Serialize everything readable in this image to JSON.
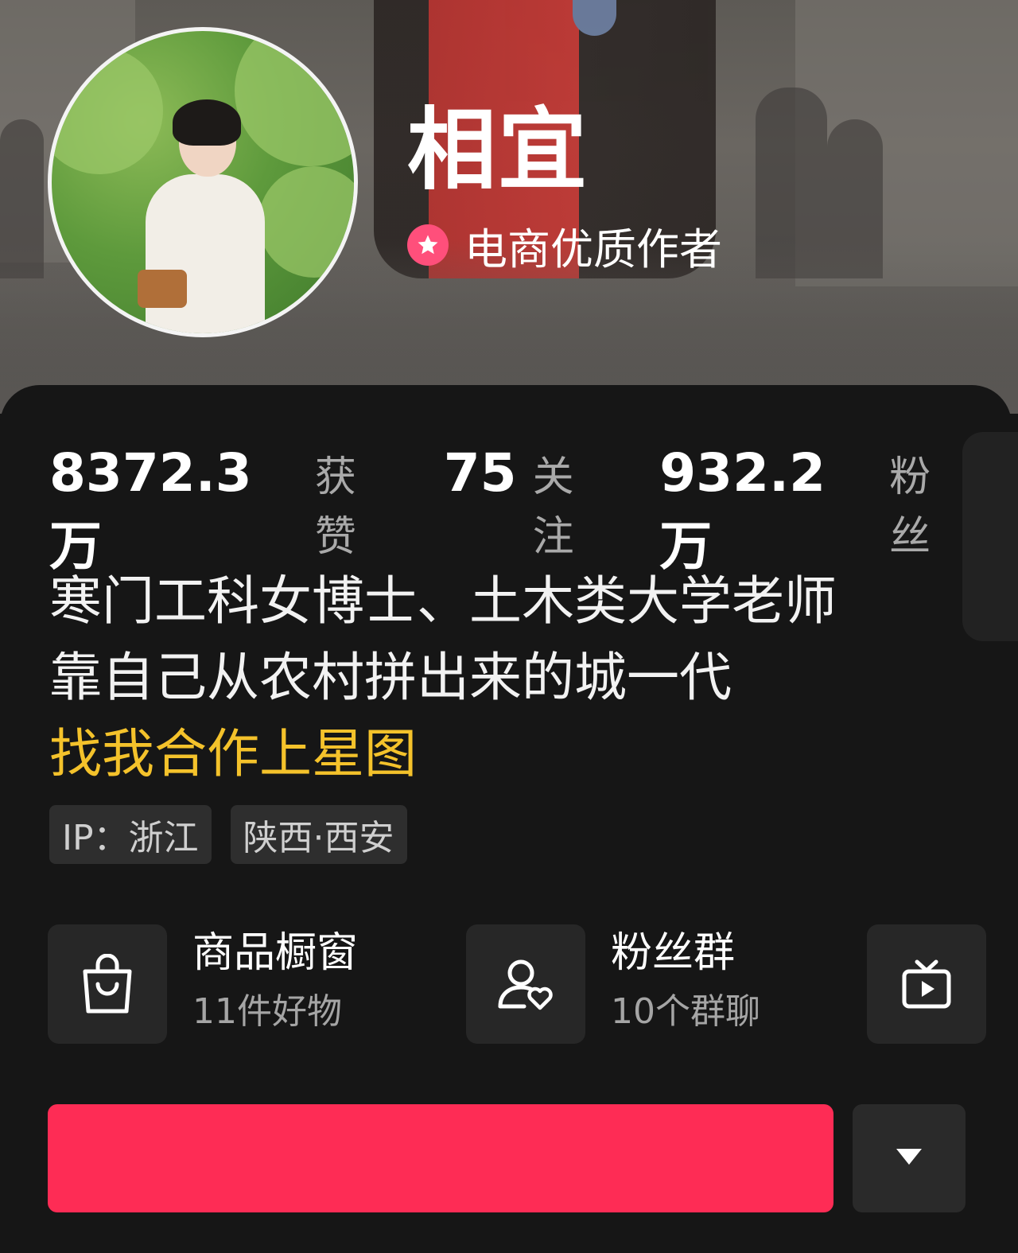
{
  "profile": {
    "name": "相宜",
    "badge": "电商优质作者"
  },
  "stats": [
    {
      "value": "8372.3万",
      "label": "获赞"
    },
    {
      "value": "75",
      "label": "关注"
    },
    {
      "value": "932.2万",
      "label": "粉丝"
    }
  ],
  "bio": {
    "lines": [
      "寒门工科女博士、土木类大学老师",
      "靠自己从农村拼出来的城一代"
    ],
    "highlight": "找我合作上星图"
  },
  "tags": [
    "IP：浙江",
    "陕西·西安"
  ],
  "features": [
    {
      "title": "商品橱窗",
      "subtitle": "11件好物",
      "icon": "shopping-bag-icon"
    },
    {
      "title": "粉丝群",
      "subtitle": "10个群聊",
      "icon": "fan-group-icon"
    },
    {
      "title": "",
      "subtitle": "",
      "icon": "tv-play-icon"
    }
  ],
  "actions": {
    "follow_label": "",
    "more_icon": "dropdown-triangle-icon"
  },
  "colors": {
    "accent": "#fe2c55",
    "highlight": "#f4c22b",
    "badge": "#ff4f7b",
    "background": "#161616"
  }
}
